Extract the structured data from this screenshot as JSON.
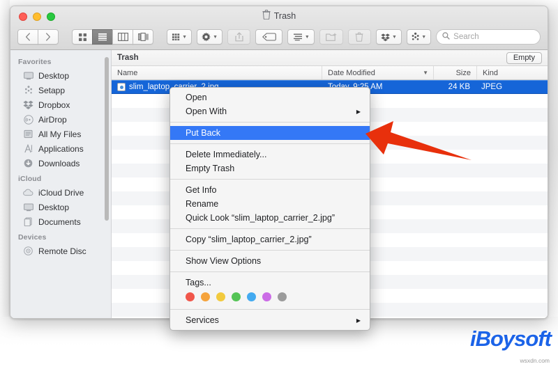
{
  "window": {
    "title": "Trash",
    "title_icon": "trash-icon",
    "traffic_lights": [
      "close",
      "minimize",
      "maximize"
    ]
  },
  "toolbar": {
    "back_icon": "chevron-left-icon",
    "forward_icon": "chevron-right-icon",
    "view_modes": [
      {
        "name": "icon-view",
        "icon": "grid-icon",
        "selected": false
      },
      {
        "name": "list-view",
        "icon": "list-icon",
        "selected": true
      },
      {
        "name": "column-view",
        "icon": "columns-icon",
        "selected": false
      },
      {
        "name": "gallery-view",
        "icon": "gallery-icon",
        "selected": false
      }
    ],
    "group_icon": "group-items-icon",
    "action_icon": "gear-icon",
    "share_icon": "share-icon",
    "tag_icon": "tag-icon",
    "arrange_icon": "arrange-icon",
    "newfolder_icon": "new-folder-icon",
    "delete_icon": "trash-icon",
    "dropbox_icon": "dropbox-icon",
    "setapp_icon": "setapp-icon",
    "search_placeholder": "Search",
    "search_value": "",
    "search_icon": "search-icon"
  },
  "sidebar": {
    "sections": [
      {
        "header": "Favorites",
        "items": [
          {
            "label": "Desktop",
            "icon": "desktop-icon"
          },
          {
            "label": "Setapp",
            "icon": "setapp-icon"
          },
          {
            "label": "Dropbox",
            "icon": "dropbox-icon"
          },
          {
            "label": "AirDrop",
            "icon": "airdrop-icon"
          },
          {
            "label": "All My Files",
            "icon": "all-my-files-icon"
          },
          {
            "label": "Applications",
            "icon": "applications-icon"
          },
          {
            "label": "Downloads",
            "icon": "downloads-icon"
          }
        ]
      },
      {
        "header": "iCloud",
        "items": [
          {
            "label": "iCloud Drive",
            "icon": "cloud-icon"
          },
          {
            "label": "Desktop",
            "icon": "desktop-icon"
          },
          {
            "label": "Documents",
            "icon": "documents-icon"
          }
        ]
      },
      {
        "header": "Devices",
        "items": [
          {
            "label": "Remote Disc",
            "icon": "disc-icon"
          }
        ]
      }
    ]
  },
  "pathbar": {
    "title": "Trash",
    "empty_button": "Empty"
  },
  "file_list": {
    "columns": [
      "Name",
      "Date Modified",
      "Size",
      "Kind"
    ],
    "sort_indicator": "chevron-down-icon",
    "rows": [
      {
        "name": "slim_laptop_carrier_2.jpg",
        "date": "Today, 9:25 AM",
        "size": "24 KB",
        "kind": "JPEG",
        "selected": true
      }
    ]
  },
  "context_menu": {
    "groups": [
      [
        {
          "label": "Open",
          "submenu": false,
          "highlighted": false
        },
        {
          "label": "Open With",
          "submenu": true,
          "highlighted": false
        }
      ],
      [
        {
          "label": "Put Back",
          "submenu": false,
          "highlighted": true
        }
      ],
      [
        {
          "label": "Delete Immediately...",
          "submenu": false,
          "highlighted": false
        },
        {
          "label": "Empty Trash",
          "submenu": false,
          "highlighted": false
        }
      ],
      [
        {
          "label": "Get Info",
          "submenu": false,
          "highlighted": false
        },
        {
          "label": "Rename",
          "submenu": false,
          "highlighted": false
        },
        {
          "label": "Quick Look “slim_laptop_carrier_2.jpg”",
          "submenu": false,
          "highlighted": false
        }
      ],
      [
        {
          "label": "Copy “slim_laptop_carrier_2.jpg”",
          "submenu": false,
          "highlighted": false
        }
      ],
      [
        {
          "label": "Show View Options",
          "submenu": false,
          "highlighted": false
        }
      ],
      [
        {
          "label": "Tags...",
          "submenu": false,
          "highlighted": false
        }
      ],
      [
        {
          "label": "Services",
          "submenu": true,
          "highlighted": false
        }
      ]
    ],
    "tag_colors": [
      "#f0564a",
      "#f5a33c",
      "#f2ca3e",
      "#55c456",
      "#43aaf0",
      "#cb6ce6",
      "#9b9b9b"
    ],
    "highlight_color": "#3478f6"
  },
  "annotation": {
    "arrow_color": "#e8300c",
    "arrow_points_to": "Put Back"
  },
  "watermark": {
    "brand": "iBoysoft",
    "brand_color": "#1b63e8",
    "sub": "wsxdn.com"
  }
}
